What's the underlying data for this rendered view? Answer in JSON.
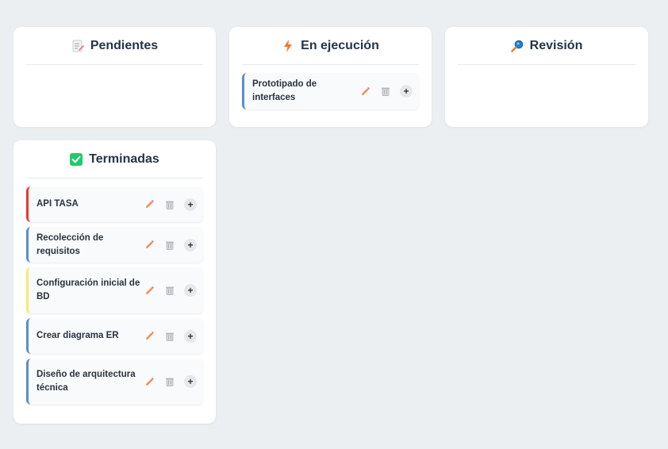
{
  "columns": {
    "pendientes": {
      "title": "Pendientes",
      "icon": "memo-icon"
    },
    "ejecucion": {
      "title": "En ejecución",
      "icon": "lightning-icon"
    },
    "revision": {
      "title": "Revisión",
      "icon": "magnifier-icon"
    },
    "terminadas": {
      "title": "Terminadas",
      "icon": "check-box-icon"
    }
  },
  "cards": {
    "ejecucion": [
      {
        "title": "Prototipado de interfaces",
        "accent": "#5b8fc7"
      }
    ],
    "terminadas": [
      {
        "title": "API TASA",
        "accent": "#e53935"
      },
      {
        "title": "Recolección de requisitos",
        "accent": "#5b8fc7"
      },
      {
        "title": "Configuración inicial de BD",
        "accent": "#f6ea73"
      },
      {
        "title": "Crear diagrama ER",
        "accent": "#5b8fc7"
      },
      {
        "title": "Diseño de arquitectura técnica",
        "accent": "#5b8fc7"
      }
    ]
  },
  "actions": {
    "plus_label": "+"
  },
  "colors": {
    "background": "#eceff1",
    "edit_icon": "#f0935a",
    "trash_icon": "#9ea4aa",
    "done_check": "#21c96b"
  }
}
